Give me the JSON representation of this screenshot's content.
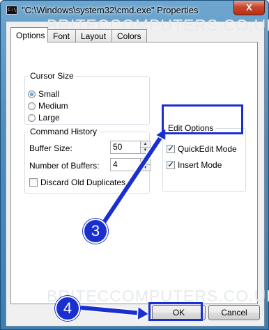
{
  "window": {
    "title": "\"C:\\Windows\\system32\\cmd.exe\" Properties",
    "icon_text": "C:\\",
    "close_label": "X"
  },
  "tabs": [
    {
      "label": "Options",
      "active": true
    },
    {
      "label": "Font",
      "active": false
    },
    {
      "label": "Layout",
      "active": false
    },
    {
      "label": "Colors",
      "active": false
    }
  ],
  "cursor_size": {
    "legend": "Cursor Size",
    "options": [
      {
        "label": "Small",
        "selected": true
      },
      {
        "label": "Medium",
        "selected": false
      },
      {
        "label": "Large",
        "selected": false
      }
    ]
  },
  "command_history": {
    "legend": "Command History",
    "buffer_size_label": "Buffer Size:",
    "buffer_size_value": "50",
    "num_buffers_label": "Number of Buffers:",
    "num_buffers_value": "4",
    "discard_label": "Discard Old Duplicates",
    "discard_checked": false
  },
  "edit_options": {
    "legend": "Edit Options",
    "quickedit_label": "QuickEdit Mode",
    "quickedit_checked": true,
    "insert_label": "Insert Mode",
    "insert_checked": true
  },
  "buttons": {
    "ok": "OK",
    "cancel": "Cancel"
  },
  "annotations": {
    "step3": "3",
    "step4": "4",
    "color": "#1a2fd0"
  },
  "watermark": "BRITECCOMPUTERS.CO.UK"
}
